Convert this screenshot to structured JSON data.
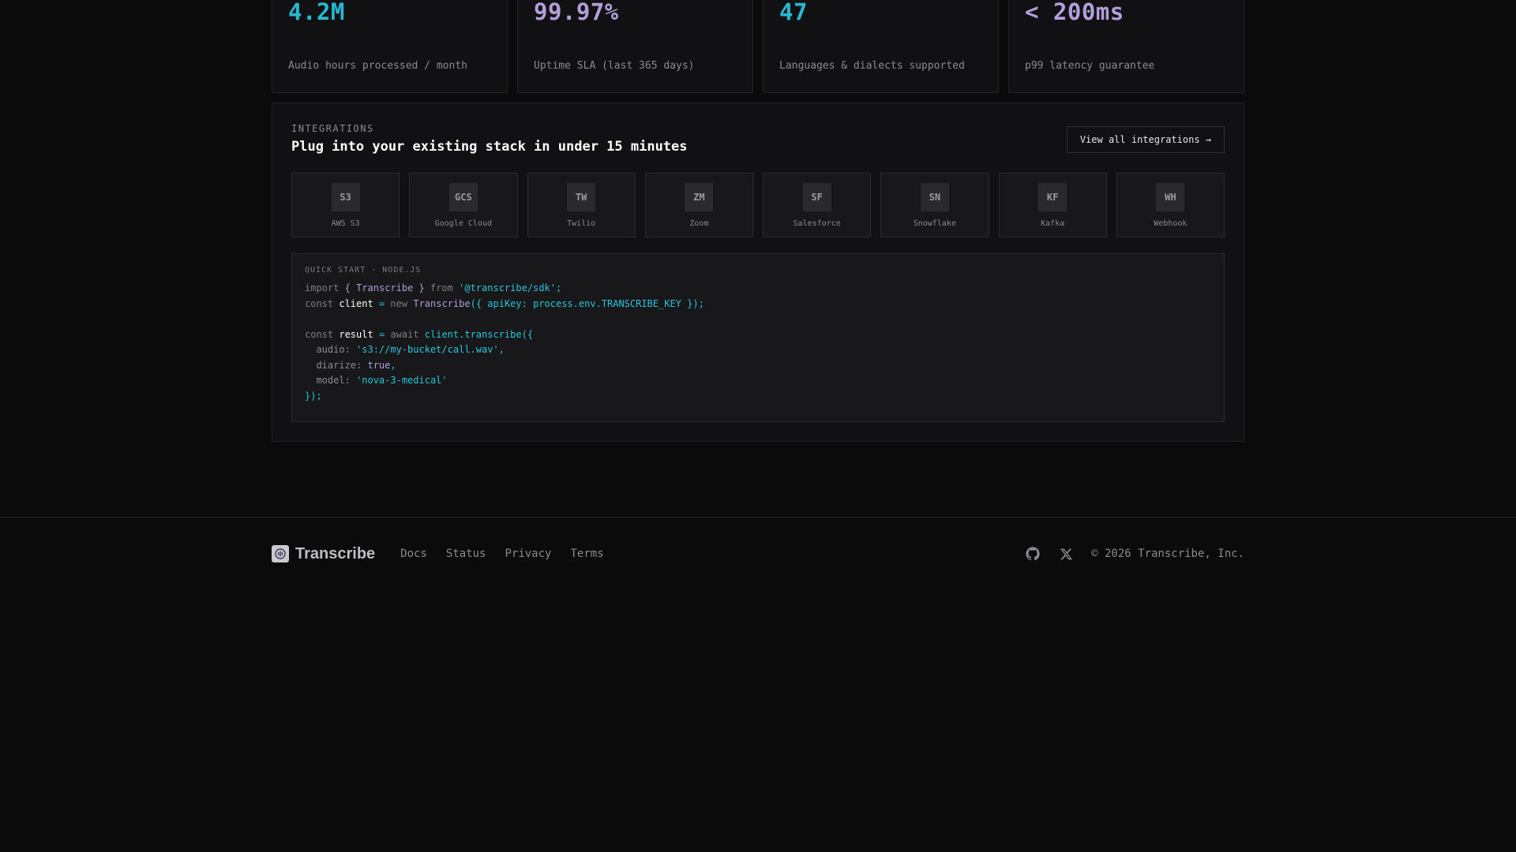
{
  "stats": [
    {
      "value": "4.2M",
      "label": "Audio hours processed / month",
      "color": "#26b9d1"
    },
    {
      "value": "99.97%",
      "label": "Uptime SLA (last 365 days)",
      "color": "#b39ddb"
    },
    {
      "value": "47",
      "label": "Languages & dialects supported",
      "color": "#26b9d1"
    },
    {
      "value": "< 200ms",
      "label": "p99 latency guarantee",
      "color": "#b39ddb"
    }
  ],
  "integrations": {
    "eyebrow": "INTEGRATIONS",
    "title": "Plug into your existing stack in under 15 minutes",
    "view_all_label": "View all integrations →",
    "items": [
      {
        "code": "S3",
        "name": "AWS S3"
      },
      {
        "code": "GCS",
        "name": "Google Cloud"
      },
      {
        "code": "TW",
        "name": "Twilio"
      },
      {
        "code": "ZM",
        "name": "Zoom"
      },
      {
        "code": "SF",
        "name": "Salesforce"
      },
      {
        "code": "SN",
        "name": "Snowflake"
      },
      {
        "code": "KF",
        "name": "Kafka"
      },
      {
        "code": "WH",
        "name": "Webhook"
      }
    ]
  },
  "quickstart": {
    "title": "QUICK START · NODE.JS",
    "code": {
      "l1": {
        "kw": "import",
        "p1": "{ ",
        "cls": "Transcribe",
        "p2": " }",
        "kw2": "from",
        "str": "'@transcribe/sdk'",
        "end": ";"
      },
      "l2": {
        "kw": "const",
        "id": "client",
        "eq": "=",
        "kw2": "new",
        "cls": "Transcribe",
        "rest": "({ apiKey: process.env.TRANSCRIBE_KEY });"
      },
      "l4": {
        "kw": "const",
        "id": "result",
        "eq": "=",
        "kw2": "await",
        "rest": "client.transcribe({"
      },
      "l5": {
        "prop": "audio",
        "str": "'s3://my-bucket/call.wav'",
        "end": ","
      },
      "l6": {
        "prop": "diarize",
        "lit": "true",
        "end": ","
      },
      "l7": {
        "prop": "model",
        "str": "'nova-3-medical'"
      },
      "l8": {
        "end": "});"
      }
    }
  },
  "footer": {
    "brand": "Transcribe",
    "links": [
      "Docs",
      "Status",
      "Privacy",
      "Terms"
    ],
    "copyright": "© 2026 Transcribe, Inc.",
    "icons": [
      "github-icon",
      "x-icon"
    ]
  }
}
